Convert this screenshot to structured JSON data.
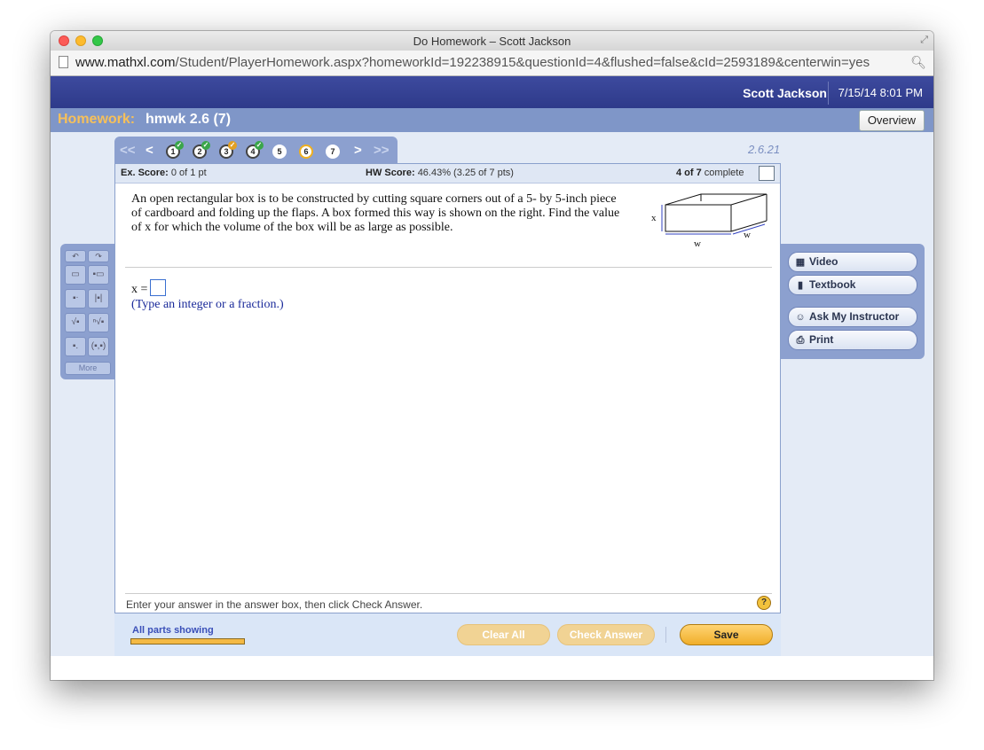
{
  "window": {
    "title": "Do Homework – Scott Jackson"
  },
  "url": {
    "host": "www.mathxl.com",
    "path": "/Student/PlayerHomework.aspx?homeworkId=192238915&questionId=4&flushed=false&cId=2593189&centerwin=yes"
  },
  "header": {
    "user": "Scott Jackson",
    "datetime": "7/15/14 8:01 PM"
  },
  "homework": {
    "label": "Homework:",
    "name": "hmwk 2.6 (7)",
    "overview_label": "Overview"
  },
  "nav": {
    "questions": [
      {
        "num": "1",
        "status": "correct"
      },
      {
        "num": "2",
        "status": "correct"
      },
      {
        "num": "3",
        "status": "partial"
      },
      {
        "num": "4",
        "status": "correct"
      },
      {
        "num": "5",
        "status": "none"
      },
      {
        "num": "6",
        "status": "current"
      },
      {
        "num": "7",
        "status": "none"
      }
    ],
    "question_id": "2.6.21"
  },
  "score": {
    "ex_label": "Ex. Score:",
    "ex_value": "0 of 1 pt",
    "hw_label": "HW Score:",
    "hw_value": "46.43% (3.25 of 7 pts)",
    "progress_bold": "4 of 7",
    "progress_rest": "complete"
  },
  "question": {
    "text": "An open rectangular box is to be constructed by cutting square corners out of a 5- by 5-inch piece of cardboard and folding up the flaps. A box formed this way is shown on the right. Find the value of x for which the volume of the box will be as large as possible.",
    "figure_labels": {
      "x": "x",
      "w1": "w",
      "w2": "w"
    },
    "answer_prefix": "x =",
    "hint": "(Type an integer or a fraction.)"
  },
  "footer": {
    "instructions": "Enter your answer in the answer box, then click Check Answer.",
    "help": "?"
  },
  "tools": {
    "more": "More"
  },
  "sidebar": {
    "video": "Video",
    "textbook": "Textbook",
    "ask": "Ask My Instructor",
    "print": "Print"
  },
  "bottom": {
    "parts": "All parts showing",
    "clear": "Clear All",
    "check": "Check Answer",
    "save": "Save"
  }
}
